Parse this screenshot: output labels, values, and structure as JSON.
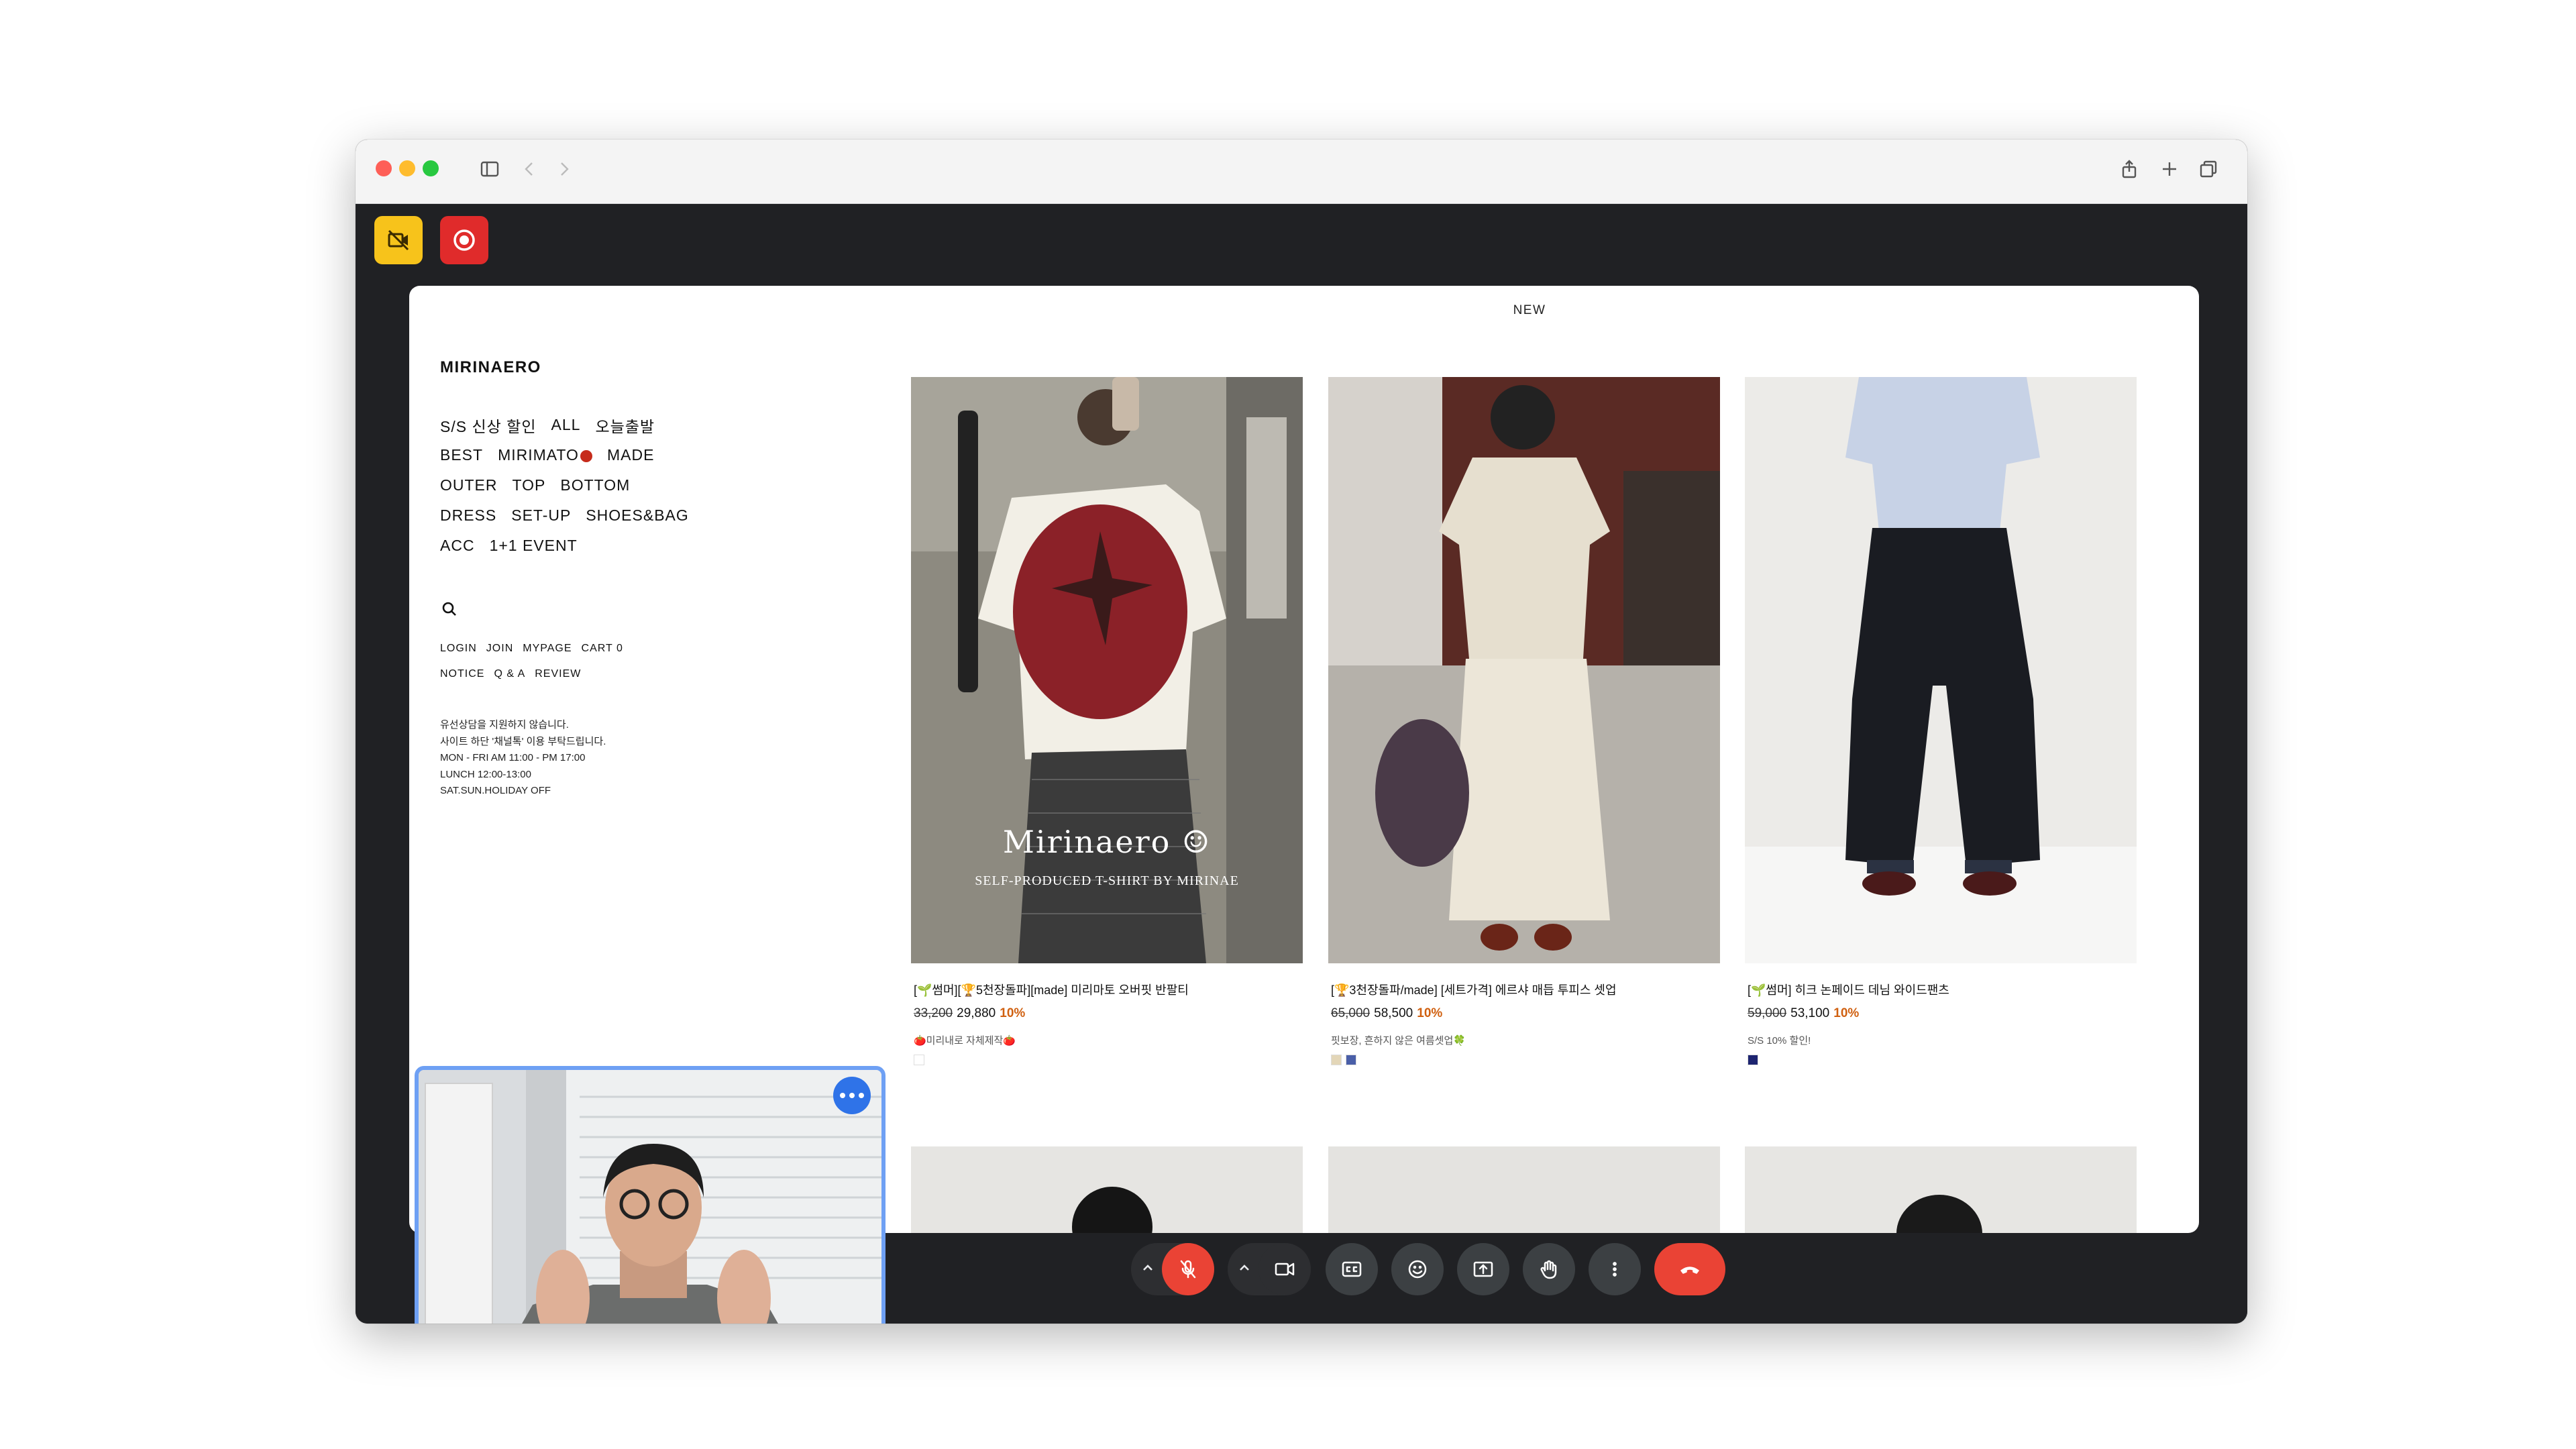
{
  "shop": {
    "new_label": "NEW",
    "logo": "MIRINAERO",
    "menu_rows": [
      [
        "S/S 신상 할인",
        "ALL",
        "오늘출발"
      ],
      [
        "BEST",
        "MIRIMATO",
        "MADE"
      ],
      [
        "OUTER",
        "TOP",
        "BOTTOM"
      ],
      [
        "DRESS",
        "SET-UP",
        "SHOES&BAG"
      ],
      [
        "ACC",
        "1+1 EVENT"
      ]
    ],
    "util_row1": [
      "LOGIN",
      "JOIN",
      "MYPAGE",
      "CART 0"
    ],
    "util_row2": [
      "NOTICE",
      "Q & A",
      "REVIEW"
    ],
    "info_lines": [
      "유선상담을 지원하지 않습니다.",
      "사이트 하단 '채널톡' 이용 부탁드립니다.",
      "MON - FRI AM 11:00 - PM 17:00",
      "LUNCH 12:00-13:00",
      "SAT.SUN.HOLIDAY OFF"
    ],
    "products": [
      {
        "name": "[🌱썸머][🏆5천장돌파][made] 미리마토 오버핏 반팔티",
        "old_price": "33,200",
        "price": "29,880",
        "discount": "10%",
        "desc": "🍅미리내로 자체제작🍅",
        "overlay_title": "Mirinaero ☺",
        "overlay_sub": "SELF-PRODUCED T-SHIRT BY MIRINAE",
        "swatches": [
          "#ffffff"
        ]
      },
      {
        "name": "[🏆3천장돌파/made] [세트가격] 에르샤 매듭 투피스 셋업",
        "old_price": "65,000",
        "price": "58,500",
        "discount": "10%",
        "desc": "핏보장, 흔하지 않은 여름셋업🍀",
        "swatches": [
          "#e3d6b8",
          "#4a5fa8"
        ]
      },
      {
        "name": "[🌱썸머] 히크 논페이드 데님 와이드팬츠",
        "old_price": "59,000",
        "price": "53,100",
        "discount": "10%",
        "desc": "S/S 10% 할인!",
        "swatches": [
          "#1d2470"
        ]
      }
    ]
  },
  "meet": {
    "top_buttons": [
      "camera-off-icon",
      "record-icon"
    ],
    "control_icons": [
      "mic-off-icon",
      "camera-icon",
      "captions-icon",
      "emoji-icon",
      "present-icon",
      "raise-hand-icon",
      "more-icon",
      "end-call-icon"
    ]
  },
  "colors": {
    "accent_red": "#ea4335",
    "self_view_border": "#6ea0f4",
    "discount": "#d06010"
  }
}
